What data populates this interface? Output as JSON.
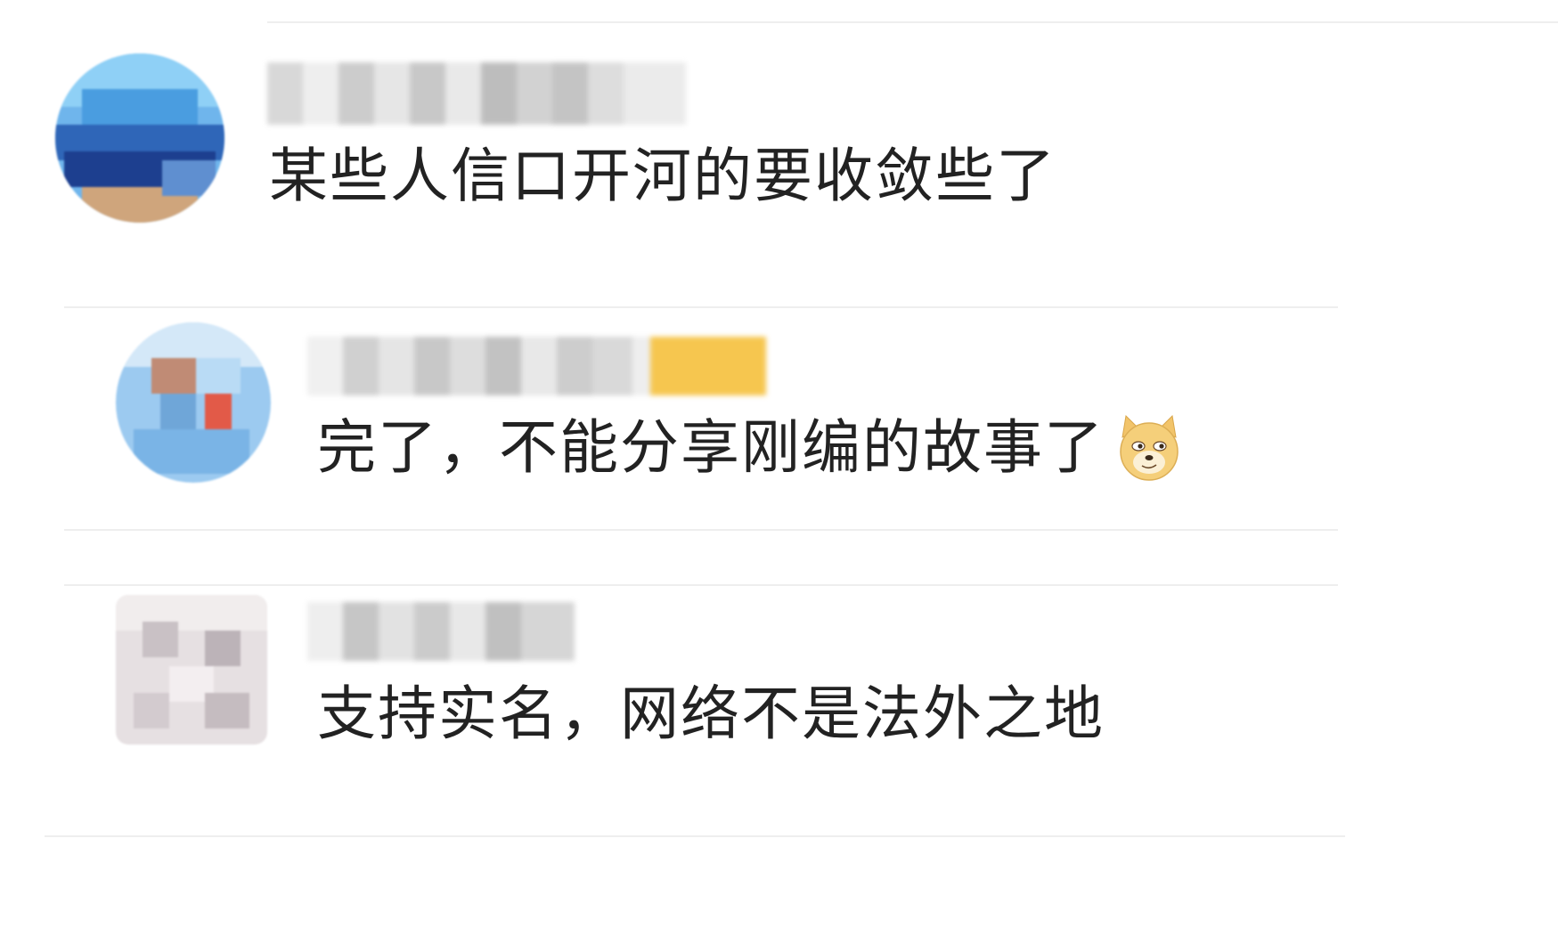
{
  "comments": [
    {
      "text": "某些人信口开河的要收敛些了",
      "avatar_colors": [
        "#5aa8e8",
        "#1f4ea0",
        "#d9b48a"
      ]
    },
    {
      "text": "完了，不能分享刚编的故事了",
      "emoji": "doge-emoji",
      "avatar_colors": [
        "#8ec3ee",
        "#c98870",
        "#e04a3a"
      ]
    },
    {
      "text": "支持实名，网络不是法外之地",
      "avatar_colors": [
        "#d8d2d4",
        "#bfb6ba",
        "#ece6e8"
      ]
    }
  ],
  "colors": {
    "text": "#222222",
    "divider": "#eeeeee",
    "background": "#ffffff"
  }
}
